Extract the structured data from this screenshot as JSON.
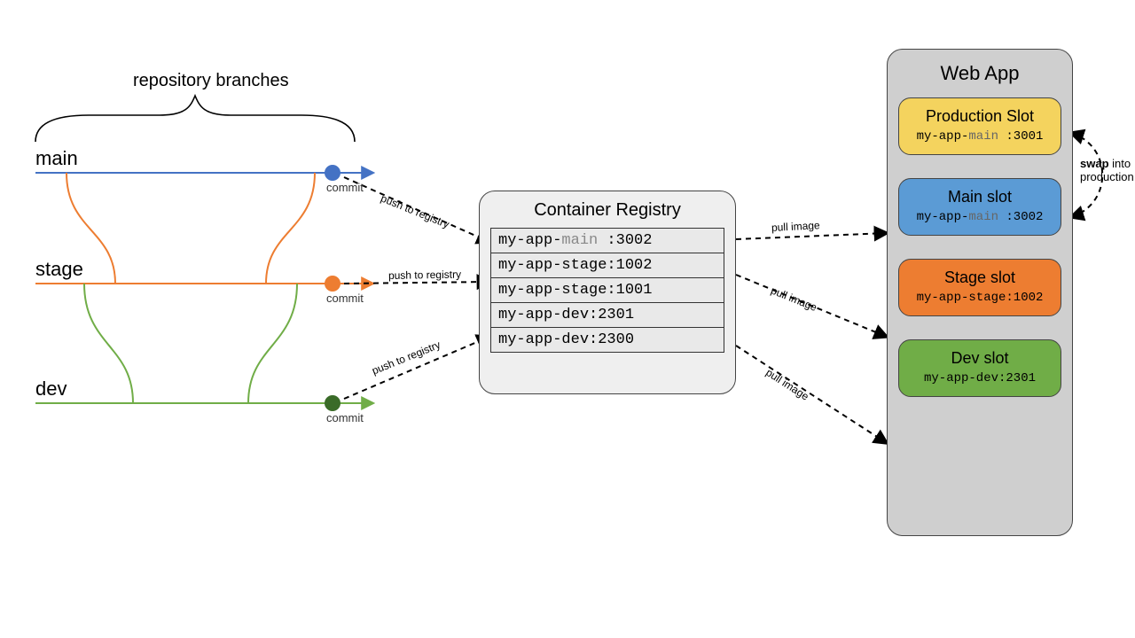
{
  "repo": {
    "title": "repository branches",
    "branches": {
      "main": {
        "label": "main",
        "color": "#4472c4"
      },
      "stage": {
        "label": "stage",
        "color": "#ed7d31"
      },
      "dev": {
        "label": "dev",
        "color": "#70ad47"
      }
    },
    "commit_label": "commit"
  },
  "edges": {
    "push_label": "push to registry",
    "pull_label": "pull image",
    "swap_bold": "swap",
    "swap_rest": " into production"
  },
  "registry": {
    "title": "Container Registry",
    "images": [
      {
        "prefix": "my-app-",
        "branch": "main",
        "suffix": " :3002",
        "gray_branch": true
      },
      {
        "prefix": "",
        "branch": "my-app-stage:1002",
        "suffix": "",
        "gray_branch": false
      },
      {
        "prefix": "",
        "branch": "my-app-stage:1001",
        "suffix": "",
        "gray_branch": false
      },
      {
        "prefix": "",
        "branch": "my-app-dev:2301",
        "suffix": "",
        "gray_branch": false
      },
      {
        "prefix": "",
        "branch": "my-app-dev:2300",
        "suffix": "",
        "gray_branch": false
      }
    ]
  },
  "webapp": {
    "title": "Web App",
    "slots": [
      {
        "key": "prod",
        "title": "Production Slot",
        "img_prefix": "my-app-",
        "img_branch": "main",
        "img_suffix": " :3001",
        "gray_branch": true,
        "class": "slot-prod"
      },
      {
        "key": "main",
        "title": "Main slot",
        "img_prefix": "my-app-",
        "img_branch": "main",
        "img_suffix": " :3002",
        "gray_branch": true,
        "class": "slot-main"
      },
      {
        "key": "stage",
        "title": "Stage slot",
        "img_prefix": "",
        "img_branch": "my-app-stage:1002",
        "img_suffix": "",
        "gray_branch": false,
        "class": "slot-stage"
      },
      {
        "key": "dev",
        "title": "Dev slot",
        "img_prefix": "",
        "img_branch": "my-app-dev:2301",
        "img_suffix": "",
        "gray_branch": false,
        "class": "slot-dev"
      }
    ]
  }
}
